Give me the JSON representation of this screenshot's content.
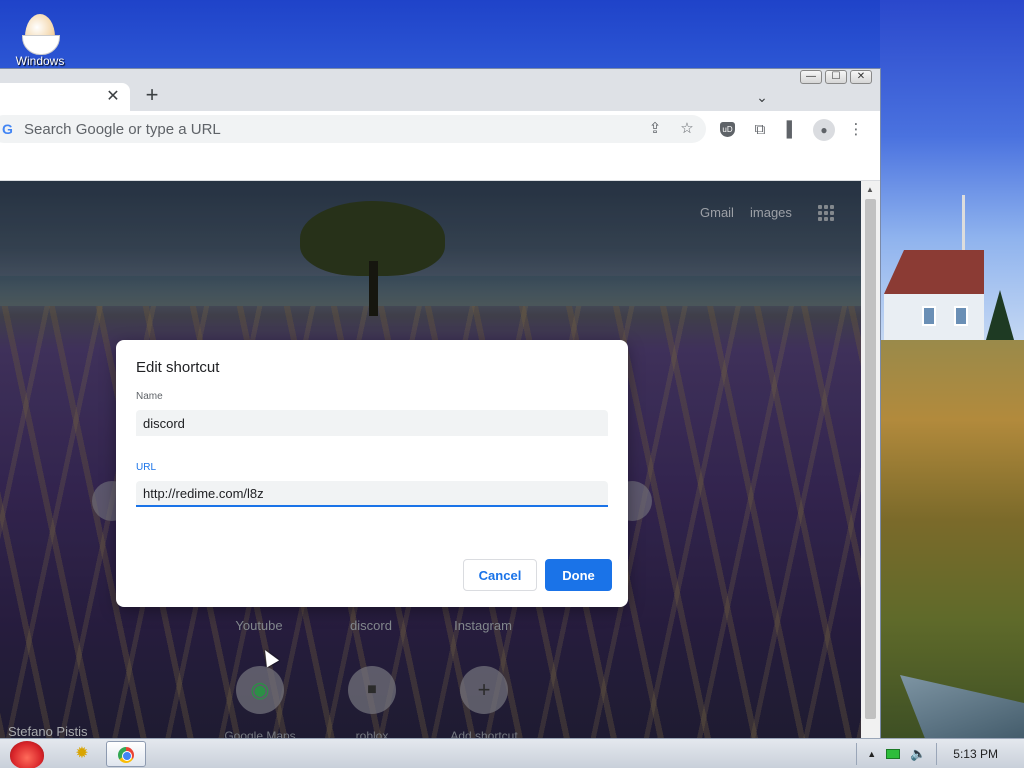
{
  "desktop": {
    "icon_label": "Windows",
    "icon_name": "egg-icon"
  },
  "window": {
    "controls": {
      "minimize": "—",
      "maximize": "☐",
      "close": "✕"
    }
  },
  "tabs": {
    "close_glyph": "✕",
    "new_tab_glyph": "+",
    "tab_search_glyph": "⌄"
  },
  "omnibox": {
    "placeholder": "Search Google or type a URL",
    "g_glyph": "G"
  },
  "toolbar": {
    "share_glyph": "⇪",
    "bookmark_glyph": "☆",
    "ublock_glyph": "uD",
    "extensions_glyph": "⧉",
    "sidepanel_glyph": "▌",
    "profile_glyph": "●",
    "menu_glyph": "⋮"
  },
  "ntp": {
    "gmail": "Gmail",
    "images": "images",
    "shortcuts_row1": [
      "Youtube",
      "discord",
      "Instagram"
    ],
    "shortcuts_row2": [
      "Google Maps",
      "roblox",
      "Add shortcut"
    ],
    "add_glyph": "+",
    "credit": "Stefano Pistis"
  },
  "dialog": {
    "title": "Edit shortcut",
    "name_label": "Name",
    "name_value": "discord",
    "url_label": "URL",
    "url_value": "http://redime.com/l8z",
    "cancel": "Cancel",
    "done": "Done"
  },
  "taskbar": {
    "clock": "5:13 PM",
    "tray_arrow": "▲",
    "volume_glyph": "🔈"
  },
  "colors": {
    "accent": "#1a73e8",
    "dialog_bg": "#ffffff",
    "tab_strip": "#dee1e6"
  }
}
